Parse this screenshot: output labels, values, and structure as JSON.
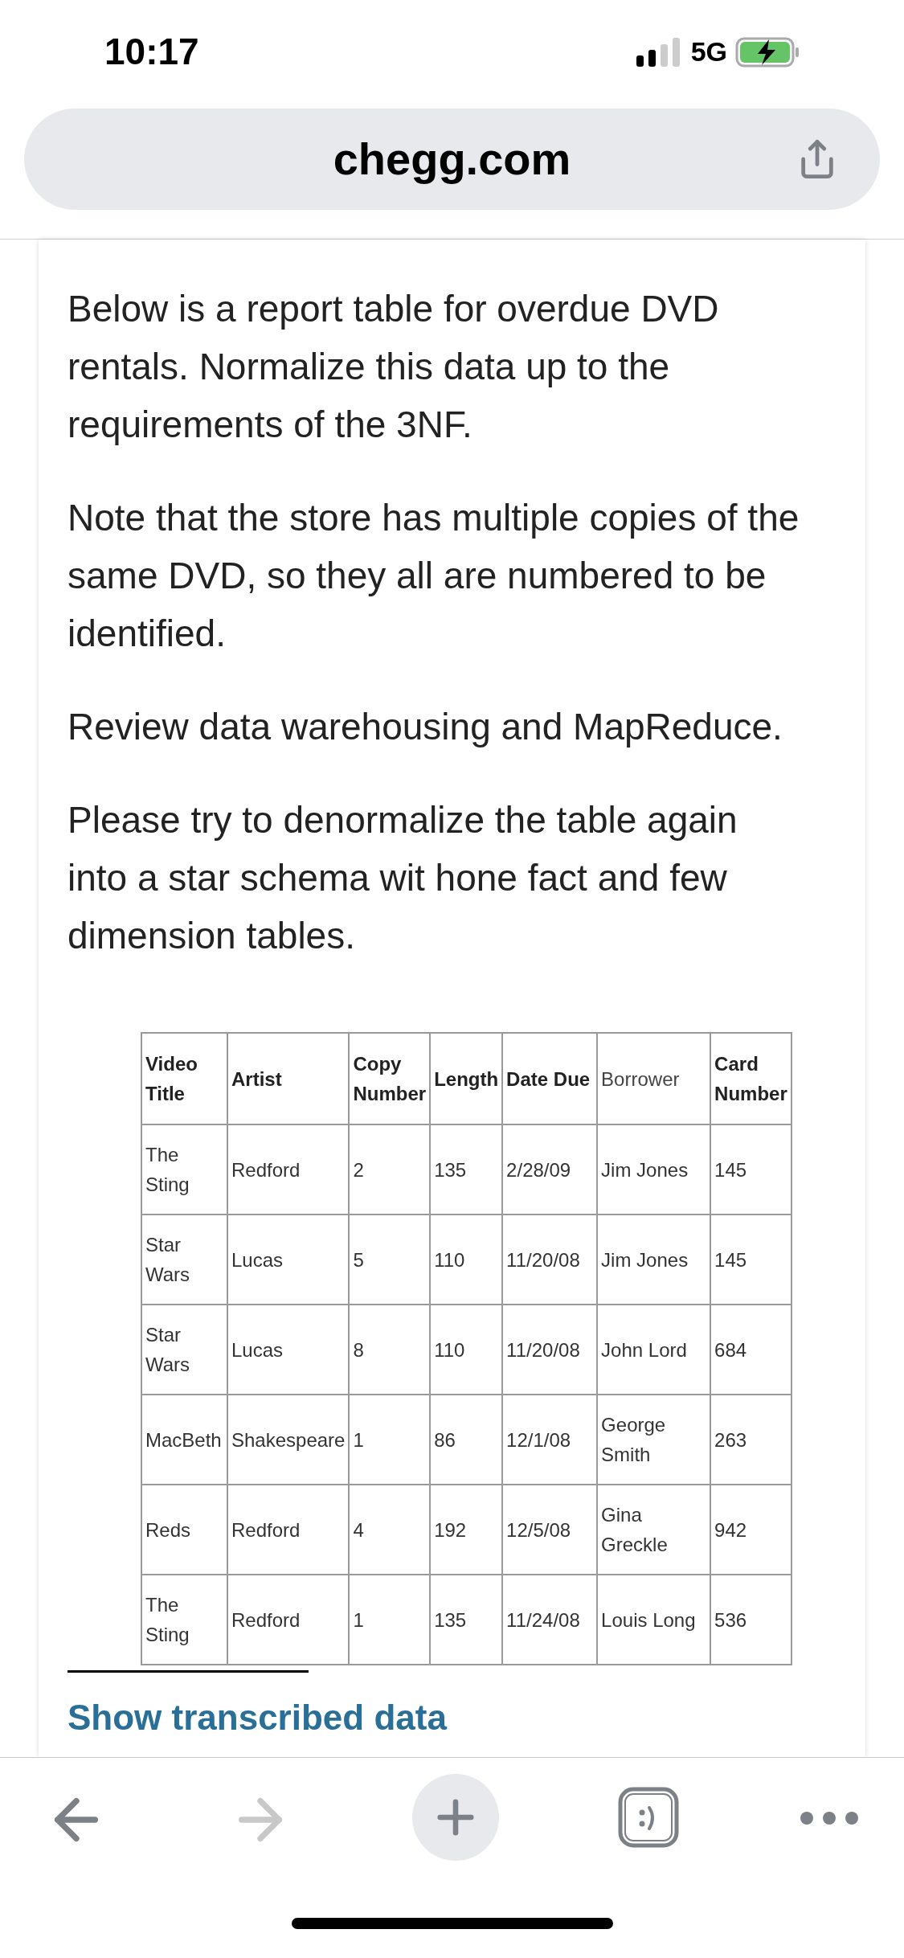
{
  "status_bar": {
    "time": "10:17",
    "network": "5G"
  },
  "address_bar": {
    "url": "chegg.com"
  },
  "question": {
    "paragraphs": [
      "Below is a report table for overdue DVD rentals. Normalize this data up to the requirements of the 3NF.",
      "Note that the store has multiple copies of the same DVD, so they all are numbered to be identified.",
      "Review data warehousing and MapReduce.",
      "Please try to denormalize the table again into a star schema wit hone fact and few dimension tables."
    ],
    "table": {
      "columns": [
        {
          "label": "Video Title",
          "bold": true
        },
        {
          "label": "Artist",
          "bold": true
        },
        {
          "label": "Copy Number",
          "bold": true
        },
        {
          "label": "Length",
          "bold": true
        },
        {
          "label": "Date Due",
          "bold": true
        },
        {
          "label": "Borrower",
          "bold": false
        },
        {
          "label": "Card Number",
          "bold": true
        }
      ],
      "rows": [
        [
          "The Sting",
          "Redford",
          "2",
          "135",
          "2/28/09",
          "Jim Jones",
          "145"
        ],
        [
          "Star Wars",
          "Lucas",
          "5",
          "110",
          "11/20/08",
          "Jim Jones",
          "145"
        ],
        [
          "Star Wars",
          "Lucas",
          "8",
          "110",
          "11/20/08",
          "John Lord",
          "684"
        ],
        [
          "MacBeth",
          "Shakespeare",
          "1",
          "86",
          "12/1/08",
          "George Smith",
          "263"
        ],
        [
          "Reds",
          "Redford",
          "4",
          "192",
          "12/5/08",
          "Gina Greckle",
          "942"
        ],
        [
          "The Sting",
          "Redford",
          "1",
          "135",
          "11/24/08",
          "Louis Long",
          "536"
        ]
      ]
    },
    "link": "Show transcribed data"
  },
  "toolbar": {
    "forward_disabled": true
  }
}
